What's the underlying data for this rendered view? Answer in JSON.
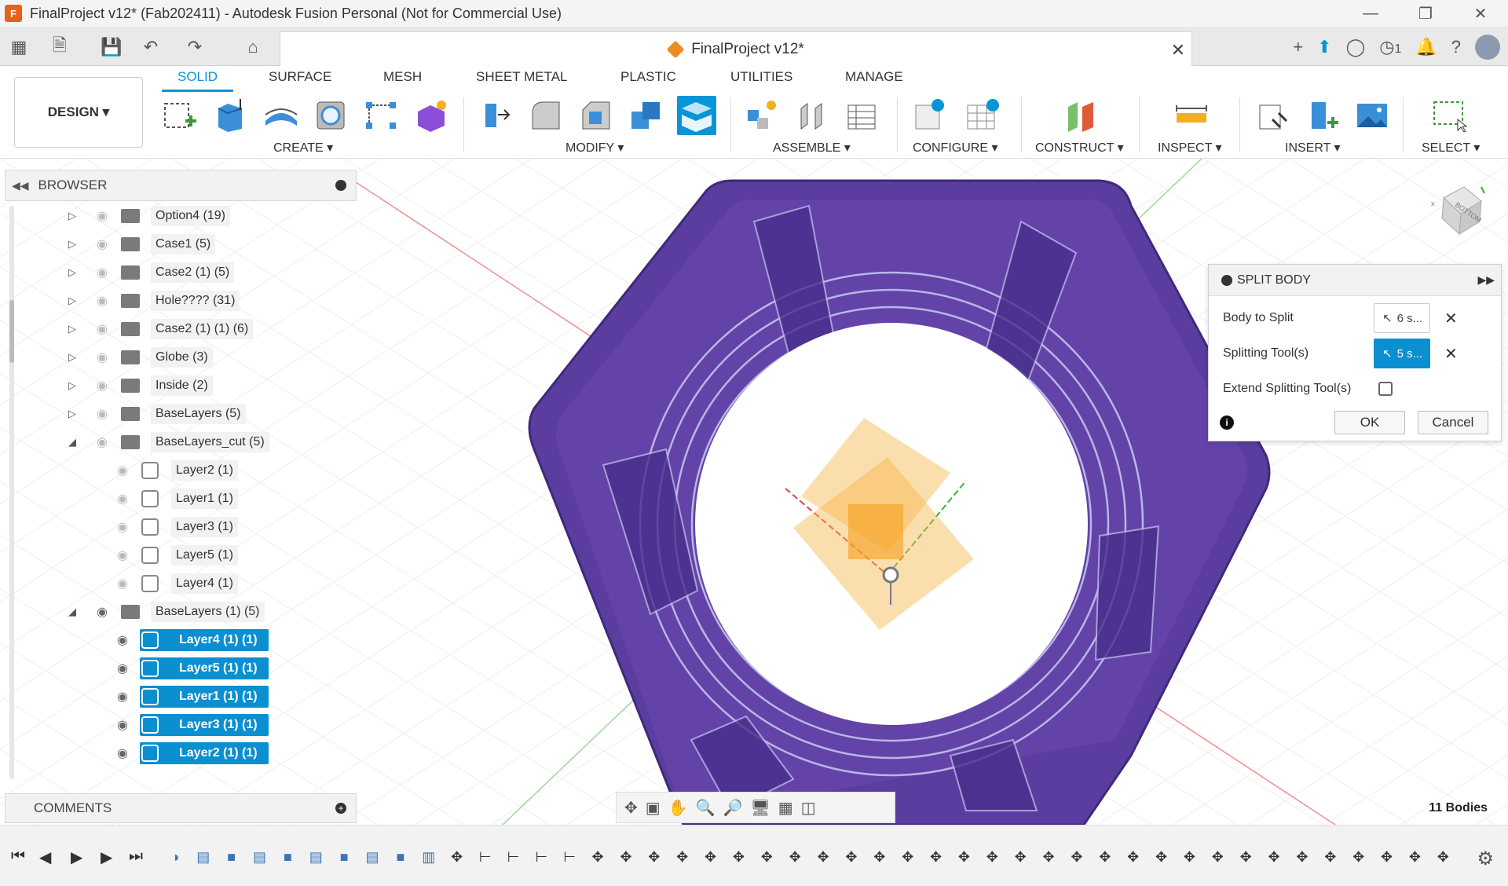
{
  "window": {
    "title": "FinalProject v12* (Fab202411) - Autodesk Fusion Personal (Not for Commercial Use)",
    "logo": "F"
  },
  "doc_tab": {
    "title": "FinalProject v12*"
  },
  "qat": {
    "notif_count": "1"
  },
  "ribbon": {
    "workspace": "DESIGN ▾",
    "tabs": [
      "SOLID",
      "SURFACE",
      "MESH",
      "SHEET METAL",
      "PLASTIC",
      "UTILITIES",
      "MANAGE"
    ],
    "groups": [
      "CREATE ▾",
      "MODIFY ▾",
      "ASSEMBLE ▾",
      "CONFIGURE ▾",
      "CONSTRUCT ▾",
      "INSPECT ▾",
      "INSERT ▾",
      "SELECT ▾"
    ]
  },
  "browser": {
    "title": "BROWSER",
    "items": [
      {
        "label": "Option4 (19)",
        "type": "folder",
        "visible": false,
        "expanded": false
      },
      {
        "label": "Case1 (5)",
        "type": "folder",
        "visible": false,
        "expanded": false
      },
      {
        "label": "Case2 (1) (5)",
        "type": "folder",
        "visible": false,
        "expanded": false
      },
      {
        "label": "Hole???? (31)",
        "type": "folder",
        "visible": false,
        "expanded": false
      },
      {
        "label": "Case2 (1) (1) (6)",
        "type": "folder",
        "visible": false,
        "expanded": false
      },
      {
        "label": "Globe (3)",
        "type": "folder",
        "visible": false,
        "expanded": false
      },
      {
        "label": "Inside (2)",
        "type": "folder",
        "visible": false,
        "expanded": false
      },
      {
        "label": "BaseLayers (5)",
        "type": "folder",
        "visible": false,
        "expanded": false
      },
      {
        "label": "BaseLayers_cut (5)",
        "type": "folder",
        "visible": false,
        "expanded": true
      },
      {
        "label": "Layer2 (1)",
        "type": "body",
        "visible": false
      },
      {
        "label": "Layer1 (1)",
        "type": "body",
        "visible": false
      },
      {
        "label": "Layer3 (1)",
        "type": "body",
        "visible": false
      },
      {
        "label": "Layer5 (1)",
        "type": "body",
        "visible": false
      },
      {
        "label": "Layer4 (1)",
        "type": "body",
        "visible": false
      },
      {
        "label": "BaseLayers (1) (5)",
        "type": "folder",
        "visible": true,
        "expanded": true
      },
      {
        "label": "Layer4 (1) (1)",
        "type": "body",
        "visible": true,
        "selected": true
      },
      {
        "label": "Layer5 (1) (1)",
        "type": "body",
        "visible": true,
        "selected": true
      },
      {
        "label": "Layer1 (1) (1)",
        "type": "body",
        "visible": true,
        "selected": true
      },
      {
        "label": "Layer3 (1) (1)",
        "type": "body",
        "visible": true,
        "selected": true
      },
      {
        "label": "Layer2 (1) (1)",
        "type": "body",
        "visible": true,
        "selected": true
      }
    ]
  },
  "comments": {
    "title": "COMMENTS"
  },
  "split_body": {
    "title": "SPLIT BODY",
    "body_to_split_label": "Body to Split",
    "body_to_split_value": "6 s...",
    "splitting_tools_label": "Splitting Tool(s)",
    "splitting_tools_value": "5 s...",
    "extend_label": "Extend Splitting Tool(s)",
    "ok": "OK",
    "cancel": "Cancel"
  },
  "viewcube": {
    "face": "BOTTOM"
  },
  "status": {
    "bodies": "11 Bodies"
  },
  "colors": {
    "accent": "#0696d7",
    "selection": "#0a8fd0",
    "part": "#5b3a9e",
    "plane": "#f7b64b"
  }
}
